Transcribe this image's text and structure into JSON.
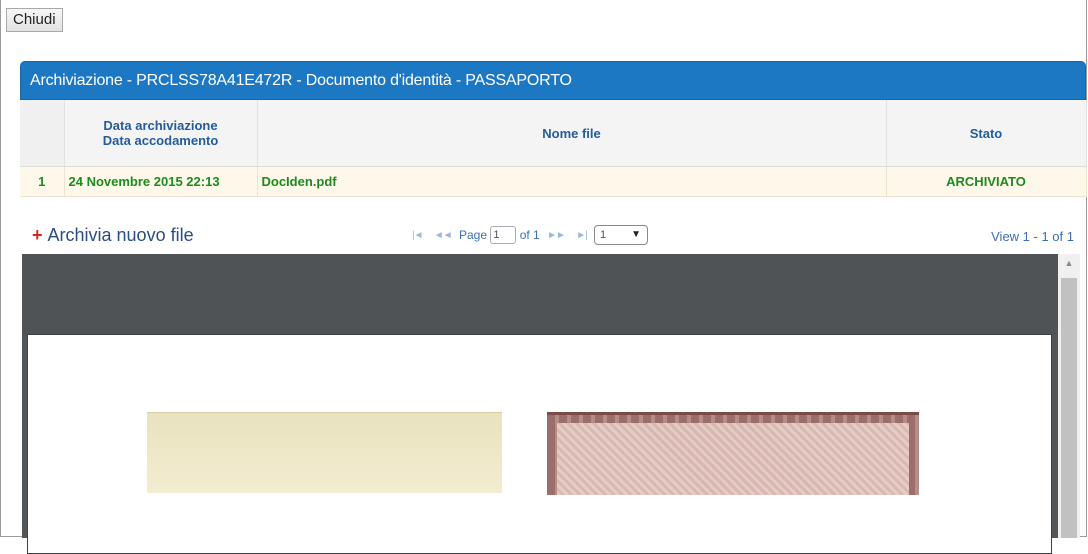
{
  "toolbar": {
    "close_label": "Chiudi"
  },
  "header": {
    "title": "Archiviazione - PRCLSS78A41E472R - Documento d'identità - PASSAPORTO"
  },
  "grid": {
    "columns": {
      "data_line1": "Data archiviazione",
      "data_line2": "Data accodamento",
      "nome_file": "Nome file",
      "stato": "Stato"
    },
    "rows": [
      {
        "num": "1",
        "data": "24 Novembre 2015 22:13",
        "nome_file": "DocIden.pdf",
        "stato": "ARCHIVIATO"
      }
    ]
  },
  "actions": {
    "add_label": "Archivia nuovo file",
    "add_icon": "plus-icon"
  },
  "pager": {
    "first_icon": "|◄",
    "prev_icon": "◄◄",
    "next_icon": "►►",
    "last_icon": "►|",
    "page_label": "Page",
    "page_value": "1",
    "of_label": "of 1",
    "rows_per_page": "1",
    "view_text": "View 1 - 1 of 1"
  },
  "colors": {
    "header_bg": "#1d78c4",
    "row_bg": "#fdf8ea",
    "row_text": "#1f8a1f",
    "column_header_text": "#245c9c",
    "viewer_bg": "#525659"
  }
}
